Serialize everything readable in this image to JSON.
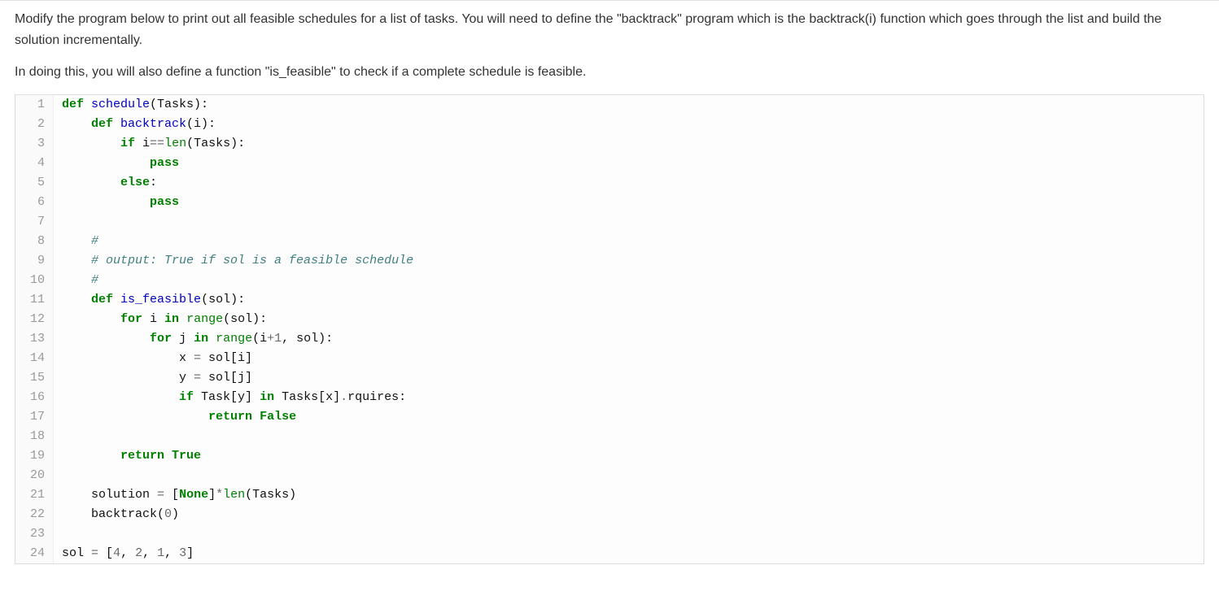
{
  "description": {
    "p1": "Modify the program below to print out all feasible schedules for a list of tasks. You will need to define the \"backtrack\" program which is the backtrack(i) function which goes through the list and build the solution incrementally.",
    "p2": "In doing this, you will also define a function \"is_feasible\" to check if a complete schedule is feasible."
  },
  "code": {
    "lines": [
      {
        "n": "1",
        "tokens": [
          [
            "def",
            "def "
          ],
          [
            "fn",
            "schedule"
          ],
          [
            "id",
            "(Tasks):"
          ]
        ]
      },
      {
        "n": "2",
        "tokens": [
          [
            "id",
            "    "
          ],
          [
            "def",
            "def "
          ],
          [
            "fn",
            "backtrack"
          ],
          [
            "id",
            "(i):"
          ]
        ]
      },
      {
        "n": "3",
        "tokens": [
          [
            "id",
            "        "
          ],
          [
            "kw",
            "if"
          ],
          [
            "id",
            " i"
          ],
          [
            "op",
            "=="
          ],
          [
            "builtin",
            "len"
          ],
          [
            "id",
            "(Tasks):"
          ]
        ]
      },
      {
        "n": "4",
        "tokens": [
          [
            "id",
            "            "
          ],
          [
            "kw",
            "pass"
          ]
        ]
      },
      {
        "n": "5",
        "tokens": [
          [
            "id",
            "        "
          ],
          [
            "kw",
            "else"
          ],
          [
            "id",
            ":"
          ]
        ]
      },
      {
        "n": "6",
        "tokens": [
          [
            "id",
            "            "
          ],
          [
            "kw",
            "pass"
          ]
        ]
      },
      {
        "n": "7",
        "tokens": [
          [
            "id",
            ""
          ]
        ]
      },
      {
        "n": "8",
        "tokens": [
          [
            "id",
            "    "
          ],
          [
            "comment",
            "#"
          ]
        ]
      },
      {
        "n": "9",
        "tokens": [
          [
            "id",
            "    "
          ],
          [
            "comment",
            "# output: True if sol is a feasible schedule"
          ]
        ]
      },
      {
        "n": "10",
        "tokens": [
          [
            "id",
            "    "
          ],
          [
            "comment",
            "#"
          ]
        ]
      },
      {
        "n": "11",
        "tokens": [
          [
            "id",
            "    "
          ],
          [
            "def",
            "def "
          ],
          [
            "fn",
            "is_feasible"
          ],
          [
            "id",
            "(sol):"
          ]
        ]
      },
      {
        "n": "12",
        "tokens": [
          [
            "id",
            "        "
          ],
          [
            "kw",
            "for"
          ],
          [
            "id",
            " i "
          ],
          [
            "kw",
            "in"
          ],
          [
            "id",
            " "
          ],
          [
            "builtin",
            "range"
          ],
          [
            "id",
            "(sol):"
          ]
        ]
      },
      {
        "n": "13",
        "tokens": [
          [
            "id",
            "            "
          ],
          [
            "kw",
            "for"
          ],
          [
            "id",
            " j "
          ],
          [
            "kw",
            "in"
          ],
          [
            "id",
            " "
          ],
          [
            "builtin",
            "range"
          ],
          [
            "id",
            "(i"
          ],
          [
            "op",
            "+"
          ],
          [
            "num",
            "1"
          ],
          [
            "id",
            ", sol):"
          ]
        ]
      },
      {
        "n": "14",
        "tokens": [
          [
            "id",
            "                x "
          ],
          [
            "op",
            "="
          ],
          [
            "id",
            " sol[i]"
          ]
        ]
      },
      {
        "n": "15",
        "tokens": [
          [
            "id",
            "                y "
          ],
          [
            "op",
            "="
          ],
          [
            "id",
            " sol[j]"
          ]
        ]
      },
      {
        "n": "16",
        "tokens": [
          [
            "id",
            "                "
          ],
          [
            "kw",
            "if"
          ],
          [
            "id",
            " Task[y] "
          ],
          [
            "kw",
            "in"
          ],
          [
            "id",
            " Tasks[x]"
          ],
          [
            "op",
            "."
          ],
          [
            "id",
            "rquires:"
          ]
        ]
      },
      {
        "n": "17",
        "tokens": [
          [
            "id",
            "                    "
          ],
          [
            "kw",
            "return"
          ],
          [
            "id",
            " "
          ],
          [
            "bool",
            "False"
          ]
        ]
      },
      {
        "n": "18",
        "tokens": [
          [
            "id",
            ""
          ]
        ]
      },
      {
        "n": "19",
        "tokens": [
          [
            "id",
            "        "
          ],
          [
            "kw",
            "return"
          ],
          [
            "id",
            " "
          ],
          [
            "bool",
            "True"
          ]
        ]
      },
      {
        "n": "20",
        "tokens": [
          [
            "id",
            ""
          ]
        ]
      },
      {
        "n": "21",
        "tokens": [
          [
            "id",
            "    solution "
          ],
          [
            "op",
            "="
          ],
          [
            "id",
            " ["
          ],
          [
            "bool",
            "None"
          ],
          [
            "id",
            "]"
          ],
          [
            "op",
            "*"
          ],
          [
            "builtin",
            "len"
          ],
          [
            "id",
            "(Tasks)"
          ]
        ]
      },
      {
        "n": "22",
        "tokens": [
          [
            "id",
            "    backtrack("
          ],
          [
            "num",
            "0"
          ],
          [
            "id",
            ")"
          ]
        ]
      },
      {
        "n": "23",
        "tokens": [
          [
            "id",
            ""
          ]
        ]
      },
      {
        "n": "24",
        "tokens": [
          [
            "id",
            "sol "
          ],
          [
            "op",
            "="
          ],
          [
            "id",
            " ["
          ],
          [
            "num",
            "4"
          ],
          [
            "id",
            ", "
          ],
          [
            "num",
            "2"
          ],
          [
            "id",
            ", "
          ],
          [
            "num",
            "1"
          ],
          [
            "id",
            ", "
          ],
          [
            "num",
            "3"
          ],
          [
            "id",
            "]"
          ]
        ]
      }
    ]
  }
}
